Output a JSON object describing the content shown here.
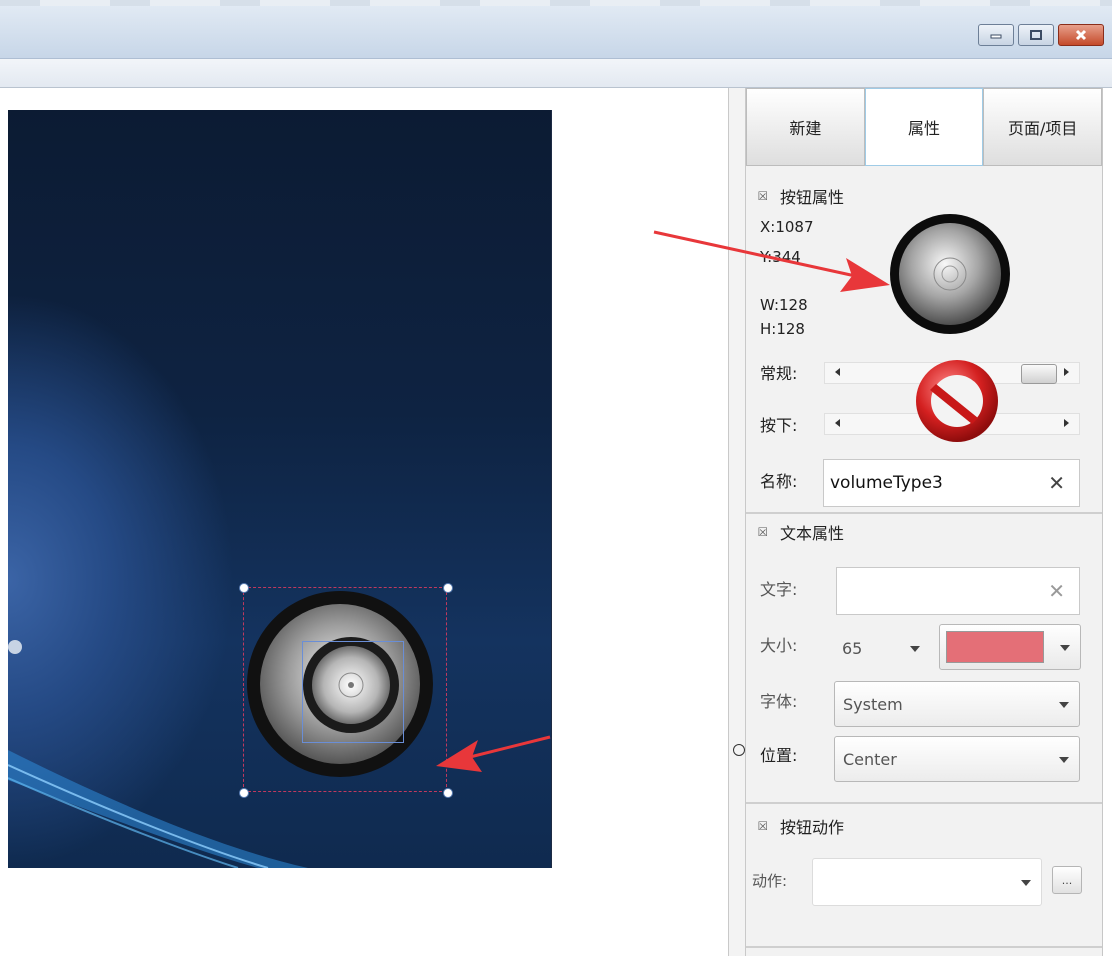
{
  "window": {
    "minimize_icon": "minimize-icon",
    "maximize_icon": "maximize-icon",
    "close_icon": "close-icon"
  },
  "tabs": [
    {
      "label": "新建",
      "active": false
    },
    {
      "label": "属性",
      "active": true
    },
    {
      "label": "页面/项目",
      "active": false
    }
  ],
  "button_props": {
    "header": "按钮属性",
    "x": "X:1087",
    "y": "Y:344",
    "w": "W:128",
    "h": "H:128",
    "normal_label": "常规:",
    "pressed_label": "按下:",
    "name_label": "名称:",
    "name_value": "volumeType3"
  },
  "text_props": {
    "header": "文本属性",
    "text_label": "文字:",
    "text_value": "",
    "size_label": "大小:",
    "size_value": "65",
    "color_value": "#e46f77",
    "font_label": "字体:",
    "font_value": "System",
    "position_label": "位置:",
    "position_value": "Center"
  },
  "button_action": {
    "header": "按钮动作",
    "action_label": "动作:",
    "action_value": "",
    "browse_label": "..."
  }
}
